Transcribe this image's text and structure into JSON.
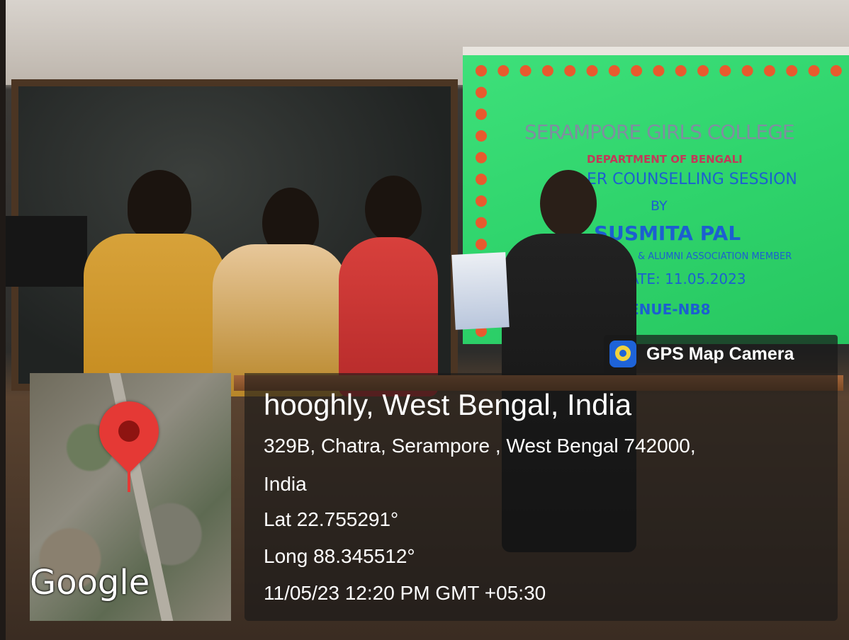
{
  "slide": {
    "college": "SERAMPORE GIRLS COLLEGE",
    "department": "DEPARTMENT OF BENGALI",
    "session": "ER COUNSELLING SESSION",
    "by": "BY",
    "speaker": "SUSMITA PAL",
    "alumni": "& ALUMNI ASSOCIATION MEMBER",
    "date": "ATE: 11.05.2023",
    "venue": "ENUE-NB8"
  },
  "overlay": {
    "app_label": "GPS Map Camera",
    "app_icon": "gps-map-camera-icon",
    "title": "hooghly, West Bengal, India",
    "address_line1": "329B, Chatra, Serampore , West Bengal 742000,",
    "address_line2": "India",
    "latitude": "Lat 22.755291°",
    "longitude": "Long 88.345512°",
    "timestamp": "11/05/23 12:20 PM GMT +05:30"
  },
  "map": {
    "brand": "Google",
    "pin_icon": "map-pin-icon",
    "pin_color": "#e53935"
  },
  "colors": {
    "slide_background": "#2fd46c",
    "overlay_background": "rgba(25,25,25,0.62)"
  }
}
